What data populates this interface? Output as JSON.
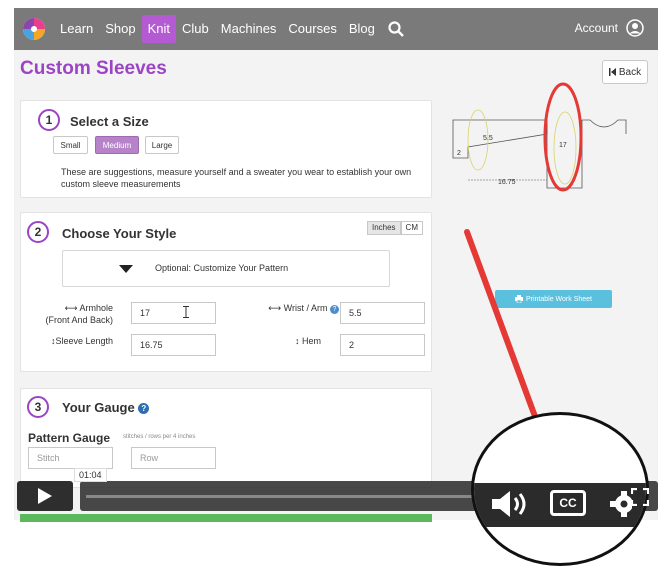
{
  "nav": {
    "items": [
      "Learn",
      "Shop",
      "Knit",
      "Club",
      "Machines",
      "Courses",
      "Blog"
    ],
    "active": "Knit",
    "account_label": "Account"
  },
  "page_title": "Custom Sleeves",
  "back_label": "Back",
  "step1": {
    "num": "1",
    "title": "Select a Size",
    "sizes": [
      "Small",
      "Medium",
      "Large"
    ],
    "selected": "Medium",
    "note": "These are suggestions, measure yourself and a sweater you wear to establish your own custom sleeve measurements"
  },
  "step2": {
    "num": "2",
    "title": "Choose Your Style",
    "units": [
      "Inches",
      "CM"
    ],
    "selected_unit": "Inches",
    "customize_label": "Optional: Customize Your Pattern",
    "fields": {
      "armhole_label": "Armhole",
      "armhole_sub": "(Front And Back)",
      "armhole_value": "17",
      "wrist_label": "Wrist / Arm",
      "wrist_value": "5.5",
      "sleeve_label": "Sleeve Length",
      "sleeve_value": "16.75",
      "hem_label": "Hem",
      "hem_value": "2"
    }
  },
  "step3": {
    "num": "3",
    "title": "Your Gauge",
    "pattern_gauge_label": "Pattern Gauge",
    "pattern_gauge_sub": "stitches / rows per 4 inches",
    "stitch_placeholder": "Stitch",
    "row_placeholder": "Row"
  },
  "diagram": {
    "label_wrist": "5.5",
    "label_hem": "2",
    "label_armhole": "17",
    "label_length": "16.75"
  },
  "print_label": "Printable Work Sheet",
  "video": {
    "timestamp": "01:04",
    "cc_label": "CC"
  },
  "colors": {
    "brand_purple": "#9b45c4",
    "nav_gray": "#7a7a7a",
    "print_blue": "#5bc0de",
    "annotation_red": "#e53935"
  }
}
